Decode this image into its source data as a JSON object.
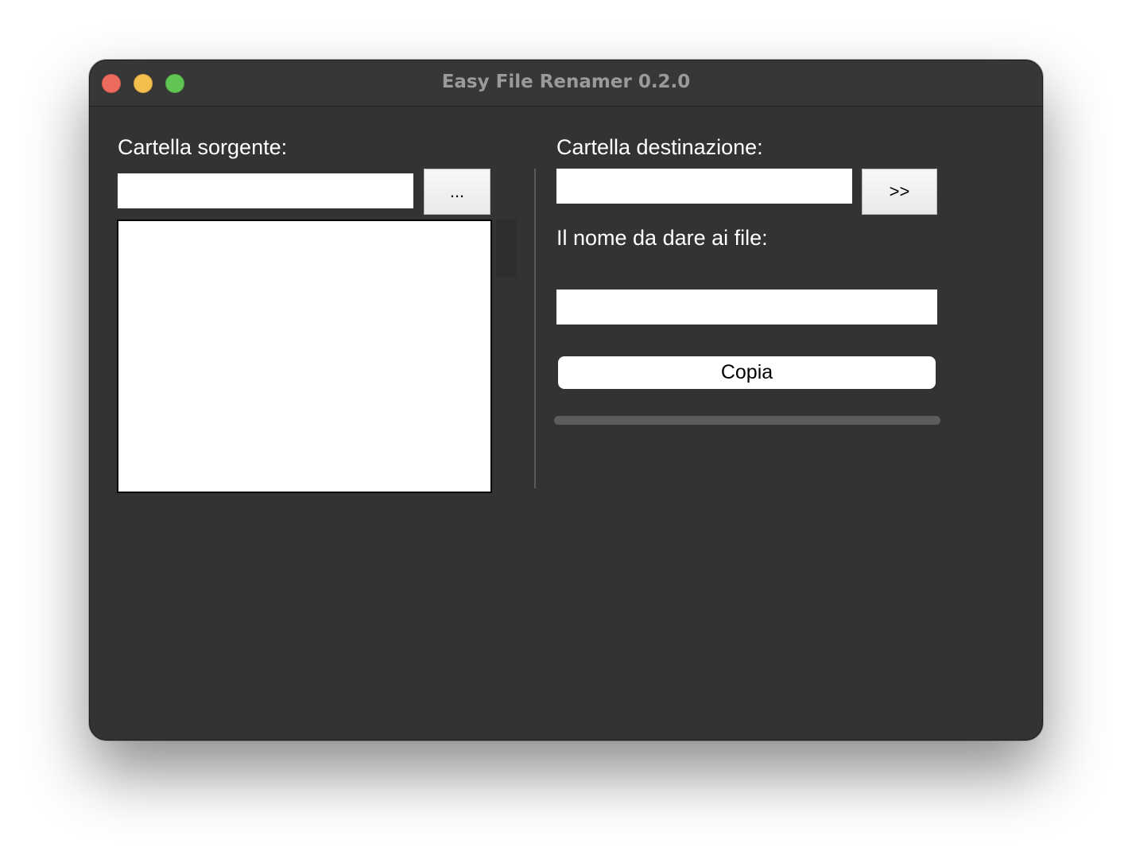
{
  "window": {
    "title": "Easy File Renamer 0.2.0"
  },
  "source": {
    "label": "Cartella sorgente:",
    "path_value": "",
    "browse_label": "...",
    "files": []
  },
  "destination": {
    "label": "Cartella destinazione:",
    "path_value": "",
    "browse_label": ">>"
  },
  "filename": {
    "label": "Il nome da dare ai file:",
    "value": ""
  },
  "actions": {
    "copy_label": "Copia"
  },
  "progress": {
    "fraction": 0
  },
  "colors": {
    "window_bg": "#333333",
    "close": "#ed6a5e",
    "minimize": "#f5bf4f",
    "maximize": "#61c554"
  }
}
